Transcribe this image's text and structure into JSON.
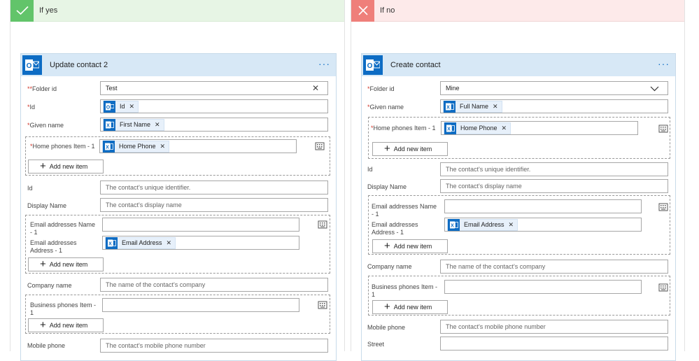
{
  "colors": {
    "accent": "#0d6cc4",
    "yes": "#62c46a",
    "no": "#ef7f7a"
  },
  "icons": {
    "check": "check-icon",
    "close": "close-icon",
    "outlook": "outlook-icon",
    "excel": "excel-icon",
    "plus": "plus-icon",
    "keyboard": "keyboard-icon",
    "dropdown": "chevron-down-icon",
    "more": "more-icon"
  },
  "yes_branch": {
    "title": "If yes",
    "card": {
      "title": "Update contact 2",
      "menu": "···",
      "folder_label": "*Folder id",
      "folder_value": "Test",
      "clear_glyph": "✕",
      "id_label": "*Id",
      "id_token": "Id",
      "given_label": "*Given name",
      "given_token": "First Name",
      "home_label": "*Home phones Item - 1",
      "home_token": "Home Phone",
      "add_item": "Add new item",
      "id2_label": "Id",
      "id2_placeholder": "The contact's unique identifier.",
      "display_label": "Display Name",
      "display_placeholder": "The contact's display name",
      "email_name_label": "Email addresses Name - 1",
      "email_addr_label": "Email addresses Address - 1",
      "email_token": "Email Address",
      "company_label": "Company name",
      "company_placeholder": "The name of the contact's company",
      "business_label": "Business phones Item - 1",
      "mobile_label": "Mobile phone",
      "mobile_placeholder": "The contact's mobile phone number"
    }
  },
  "no_branch": {
    "title": "If no",
    "card": {
      "title": "Create contact",
      "menu": "···",
      "folder_label": "*Folder id",
      "folder_value": "Mine",
      "given_label": "*Given name",
      "given_token": "Full Name",
      "home_label": "*Home phones Item - 1",
      "home_token": "Home Phone",
      "add_item": "Add new item",
      "id_label": "Id",
      "id_placeholder": "The contact's unique identifier.",
      "display_label": "Display Name",
      "display_placeholder": "The contact's display name",
      "email_name_label": "Email addresses Name - 1",
      "email_addr_label": "Email addresses Address - 1",
      "email_token": "Email Address",
      "company_label": "Company name",
      "company_placeholder": "The name of the contact's company",
      "business_label": "Business phones Item - 1",
      "mobile_label": "Mobile phone",
      "mobile_placeholder": "The contact's mobile phone number",
      "street_label": "Street"
    }
  }
}
